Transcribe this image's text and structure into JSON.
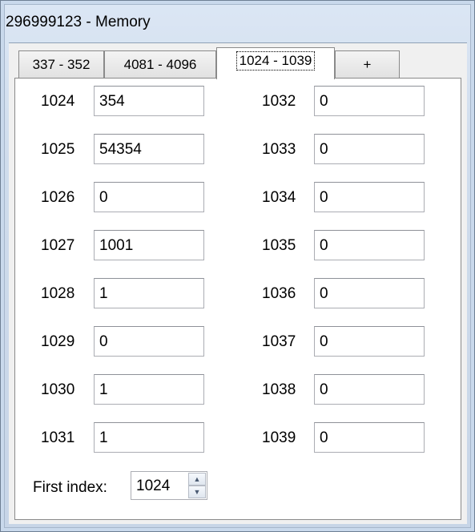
{
  "window": {
    "title": "296999123 - Memory"
  },
  "tabs": [
    {
      "label": "337 - 352"
    },
    {
      "label": "4081 - 4096"
    },
    {
      "label": "1024 - 1039"
    },
    {
      "label": "+"
    }
  ],
  "active_tab": "1024 - 1039",
  "memory": {
    "left": [
      {
        "index": "1024",
        "value": "354"
      },
      {
        "index": "1025",
        "value": "54354"
      },
      {
        "index": "1026",
        "value": "0"
      },
      {
        "index": "1027",
        "value": "1001"
      },
      {
        "index": "1028",
        "value": "1"
      },
      {
        "index": "1029",
        "value": "0"
      },
      {
        "index": "1030",
        "value": "1"
      },
      {
        "index": "1031",
        "value": "1"
      }
    ],
    "right": [
      {
        "index": "1032",
        "value": "0"
      },
      {
        "index": "1033",
        "value": "0"
      },
      {
        "index": "1034",
        "value": "0"
      },
      {
        "index": "1035",
        "value": "0"
      },
      {
        "index": "1036",
        "value": "0"
      },
      {
        "index": "1037",
        "value": "0"
      },
      {
        "index": "1038",
        "value": "0"
      },
      {
        "index": "1039",
        "value": "0"
      }
    ]
  },
  "first_index": {
    "label": "First index:",
    "value": "1024"
  },
  "colors": {
    "window_frame": "#c9d9ec",
    "client_background": "#f0f0f0",
    "panel_background": "#ffffff"
  },
  "icons": {
    "spin_up": "spin-up-arrow-icon",
    "spin_down": "spin-down-arrow-icon"
  }
}
